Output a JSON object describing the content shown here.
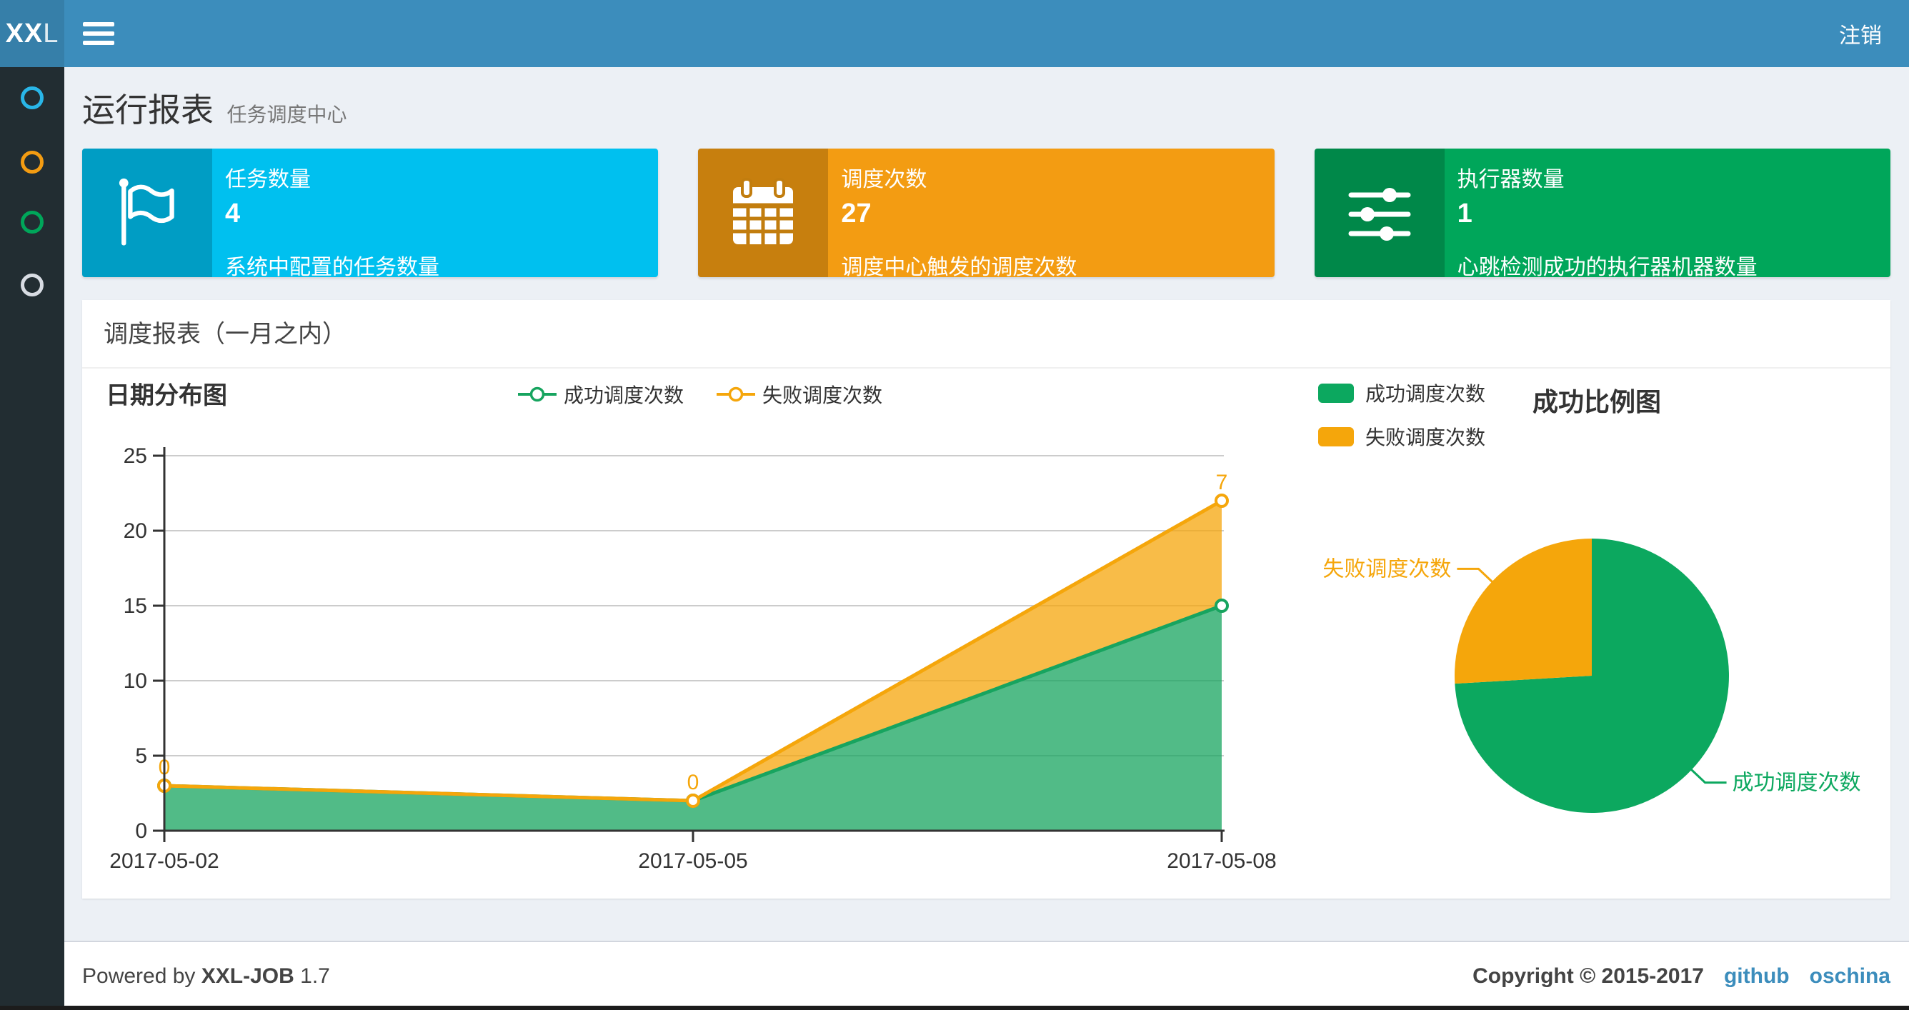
{
  "navbar": {
    "logo_bold": "XX",
    "logo_light": "L",
    "logout": "注销"
  },
  "sidebar": {
    "items": [
      {
        "name": "menu-report",
        "color": "#29b6e8"
      },
      {
        "name": "menu-jobs",
        "color": "#f39c12"
      },
      {
        "name": "menu-logs",
        "color": "#00a65a"
      },
      {
        "name": "menu-other",
        "color": "#d8dce3"
      }
    ]
  },
  "page_header": {
    "title": "运行报表",
    "subtitle": "任务调度中心"
  },
  "info_boxes": [
    {
      "label": "任务数量",
      "value": "4",
      "description": "系统中配置的任务数量",
      "color": "#00c0ef",
      "icon": "flag-icon"
    },
    {
      "label": "调度次数",
      "value": "27",
      "description": "调度中心触发的调度次数",
      "color": "#f39c12",
      "icon": "calendar-icon"
    },
    {
      "label": "执行器数量",
      "value": "1",
      "description": "心跳检测成功的执行器机器数量",
      "color": "#00a65a",
      "icon": "sliders-icon"
    }
  ],
  "panel": {
    "title": "调度报表（一月之内）"
  },
  "chart_data": [
    {
      "type": "area",
      "title": "日期分布图",
      "stacked": true,
      "categories": [
        "2017-05-02",
        "2017-05-05",
        "2017-05-08"
      ],
      "series": [
        {
          "name": "成功调度次数",
          "color": "#17a45f",
          "fill": "#17a45f",
          "fill_opacity": 0.75,
          "values": [
            3,
            2,
            15
          ]
        },
        {
          "name": "失败调度次数",
          "color": "#f5a60b",
          "fill": "#f5a60b",
          "fill_opacity": 0.75,
          "values": [
            0,
            0,
            7
          ],
          "point_labels": [
            "0",
            "0",
            "7"
          ]
        }
      ],
      "ylim": [
        0,
        25
      ],
      "yticks": [
        0,
        5,
        10,
        15,
        20,
        25
      ],
      "grid": true,
      "legend_position": "top-center"
    },
    {
      "type": "pie",
      "title": "成功比例图",
      "slices": [
        {
          "label": "成功调度次数",
          "value": 20,
          "color": "#0ca85f"
        },
        {
          "label": "失败调度次数",
          "value": 7,
          "color": "#f5a60b"
        }
      ],
      "total": 27,
      "legend": [
        "成功调度次数",
        "失败调度次数"
      ],
      "legend_position": "top-left"
    }
  ],
  "footer": {
    "powered_prefix": "Powered by ",
    "product": "XXL-JOB",
    "version": " 1.7",
    "copyright": "Copyright © 2015-2017",
    "links": [
      "github",
      "oschina"
    ]
  }
}
